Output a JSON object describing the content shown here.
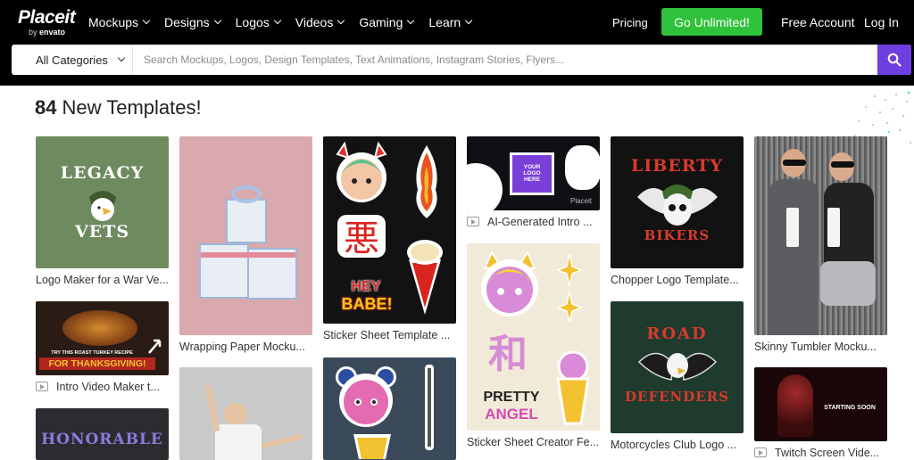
{
  "header": {
    "logo_brand": "Placeit",
    "logo_sub_by": "by",
    "logo_sub_envato": "envato",
    "nav": [
      "Mockups",
      "Designs",
      "Logos",
      "Videos",
      "Gaming",
      "Learn"
    ],
    "pricing": "Pricing",
    "go_unlimited": "Go Unlimited!",
    "free_account": "Free Account",
    "log_in": "Log In"
  },
  "search": {
    "category": "All Categories",
    "placeholder": "Search Mockups, Logos, Design Templates, Text Animations, Instagram Stories, Flyers..."
  },
  "main": {
    "count": "84",
    "title": "New Templates!"
  },
  "cards": [
    {
      "caption": "Logo Maker for a War Ve...",
      "line1": "LEGACY",
      "line2": "VETS"
    },
    {
      "caption": "Intro Video Maker t...",
      "line1": "TRY THIS ROAST TURKEY RECIPE",
      "line2": "FOR THANKSGIVING!"
    },
    {
      "line1": "HONORABLE"
    },
    {
      "caption": "Wrapping Paper Mocku..."
    },
    {
      "caption": "Sticker Sheet Template ...",
      "line1": "HEY",
      "line2": "BABE!"
    },
    {
      "caption": "AI-Generated Intro ...",
      "line1": "YOUR LOGO HERE",
      "line2": "Placeit"
    },
    {
      "caption": "Sticker Sheet Creator Fe...",
      "line1": "PRETTY",
      "line2": "ANGEL",
      "glyph": "和"
    },
    {
      "caption": "Chopper Logo Template...",
      "line1": "LIBERTY",
      "line2": "BIKERS"
    },
    {
      "caption": "Motorcycles Club Logo ...",
      "line1": "ROAD",
      "line2": "DEFENDERS"
    },
    {
      "caption": "Skinny Tumbler Mocku..."
    },
    {
      "caption": "Twitch Screen Vide...",
      "line1": "STARTING SOON"
    }
  ],
  "colors": {
    "accent_green": "#2fc23a",
    "search_purple": "#6d3fe0"
  }
}
